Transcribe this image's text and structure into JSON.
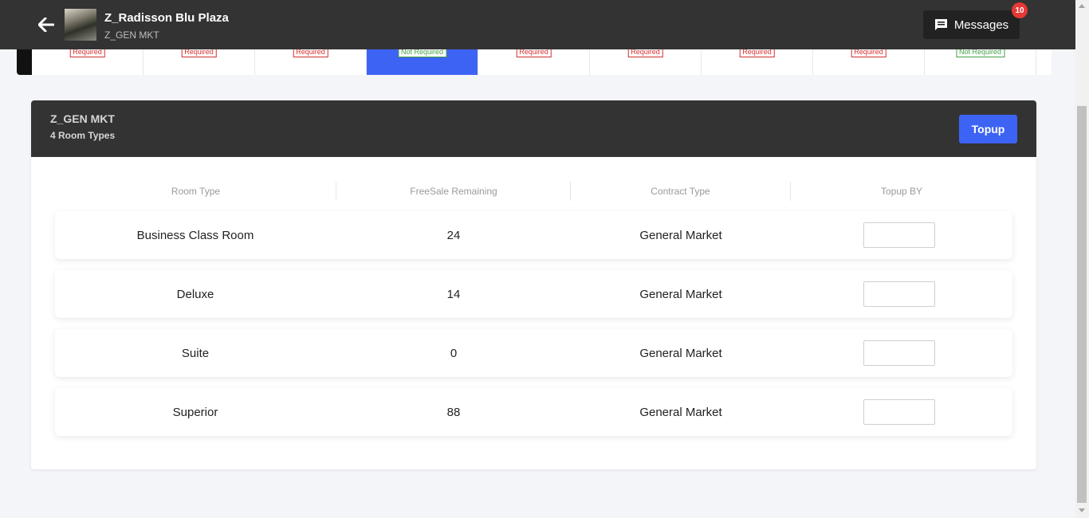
{
  "header": {
    "title": "Z_Radisson Blu Plaza",
    "subtitle": "Z_GEN MKT",
    "messages_label": "Messages",
    "messages_count": "10"
  },
  "date_strip": [
    {
      "tag": "Required",
      "status": "required",
      "active": false
    },
    {
      "tag": "Required",
      "status": "required",
      "active": false
    },
    {
      "tag": "Required",
      "status": "required",
      "active": false
    },
    {
      "tag": "Not Required",
      "status": "not-required",
      "active": true
    },
    {
      "tag": "Required",
      "status": "required",
      "active": false
    },
    {
      "tag": "Required",
      "status": "required",
      "active": false
    },
    {
      "tag": "Required",
      "status": "required",
      "active": false
    },
    {
      "tag": "Required",
      "status": "required",
      "active": false
    },
    {
      "tag": "Not Required",
      "status": "not-required",
      "active": false
    }
  ],
  "panel": {
    "title": "Z_GEN MKT",
    "subtitle": "4 Room Types",
    "topup_label": "Topup"
  },
  "table": {
    "columns": [
      "Room Type",
      "FreeSale Remaining",
      "Contract Type",
      "Topup BY"
    ],
    "rows": [
      {
        "room_type": "Business Class Room",
        "freesale": "24",
        "contract": "General Market",
        "topup": ""
      },
      {
        "room_type": "Deluxe",
        "freesale": "14",
        "contract": "General Market",
        "topup": ""
      },
      {
        "room_type": "Suite",
        "freesale": "0",
        "contract": "General Market",
        "topup": ""
      },
      {
        "room_type": "Superior",
        "freesale": "88",
        "contract": "General Market",
        "topup": ""
      }
    ]
  },
  "colors": {
    "header_bg": "#333333",
    "accent": "#3d63f5",
    "required": "#d32f2f",
    "not_required": "#43a047",
    "badge": "#e53935"
  },
  "icons": {
    "back": "arrow-left-icon",
    "messages": "chat-icon"
  }
}
